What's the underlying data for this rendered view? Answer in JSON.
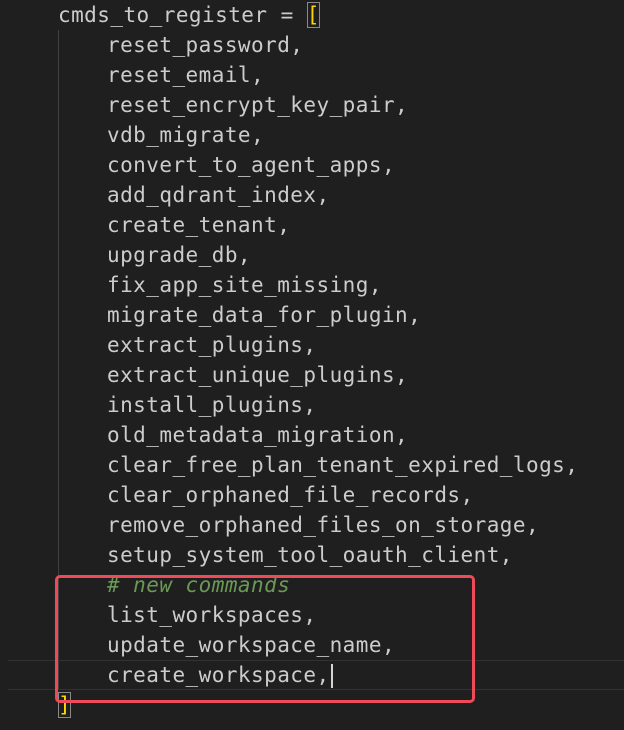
{
  "code": {
    "assignment": "cmds_to_register = ",
    "open_bracket": "[",
    "close_bracket": "]",
    "items": [
      "reset_password,",
      "reset_email,",
      "reset_encrypt_key_pair,",
      "vdb_migrate,",
      "convert_to_agent_apps,",
      "add_qdrant_index,",
      "create_tenant,",
      "upgrade_db,",
      "fix_app_site_missing,",
      "migrate_data_for_plugin,",
      "extract_plugins,",
      "extract_unique_plugins,",
      "install_plugins,",
      "old_metadata_migration,",
      "clear_free_plan_tenant_expired_logs,",
      "clear_orphaned_file_records,",
      "remove_orphaned_files_on_storage,",
      "setup_system_tool_oauth_client,"
    ],
    "comment": "# new commands",
    "new_items": [
      "list_workspaces,",
      "update_workspace_name,",
      "create_workspace,"
    ]
  },
  "colors": {
    "background": "#1f1f1f",
    "text": "#cccccc",
    "comment": "#6a9955",
    "bracket": "#ffd700",
    "annotation_box": "#ef4a5a"
  }
}
